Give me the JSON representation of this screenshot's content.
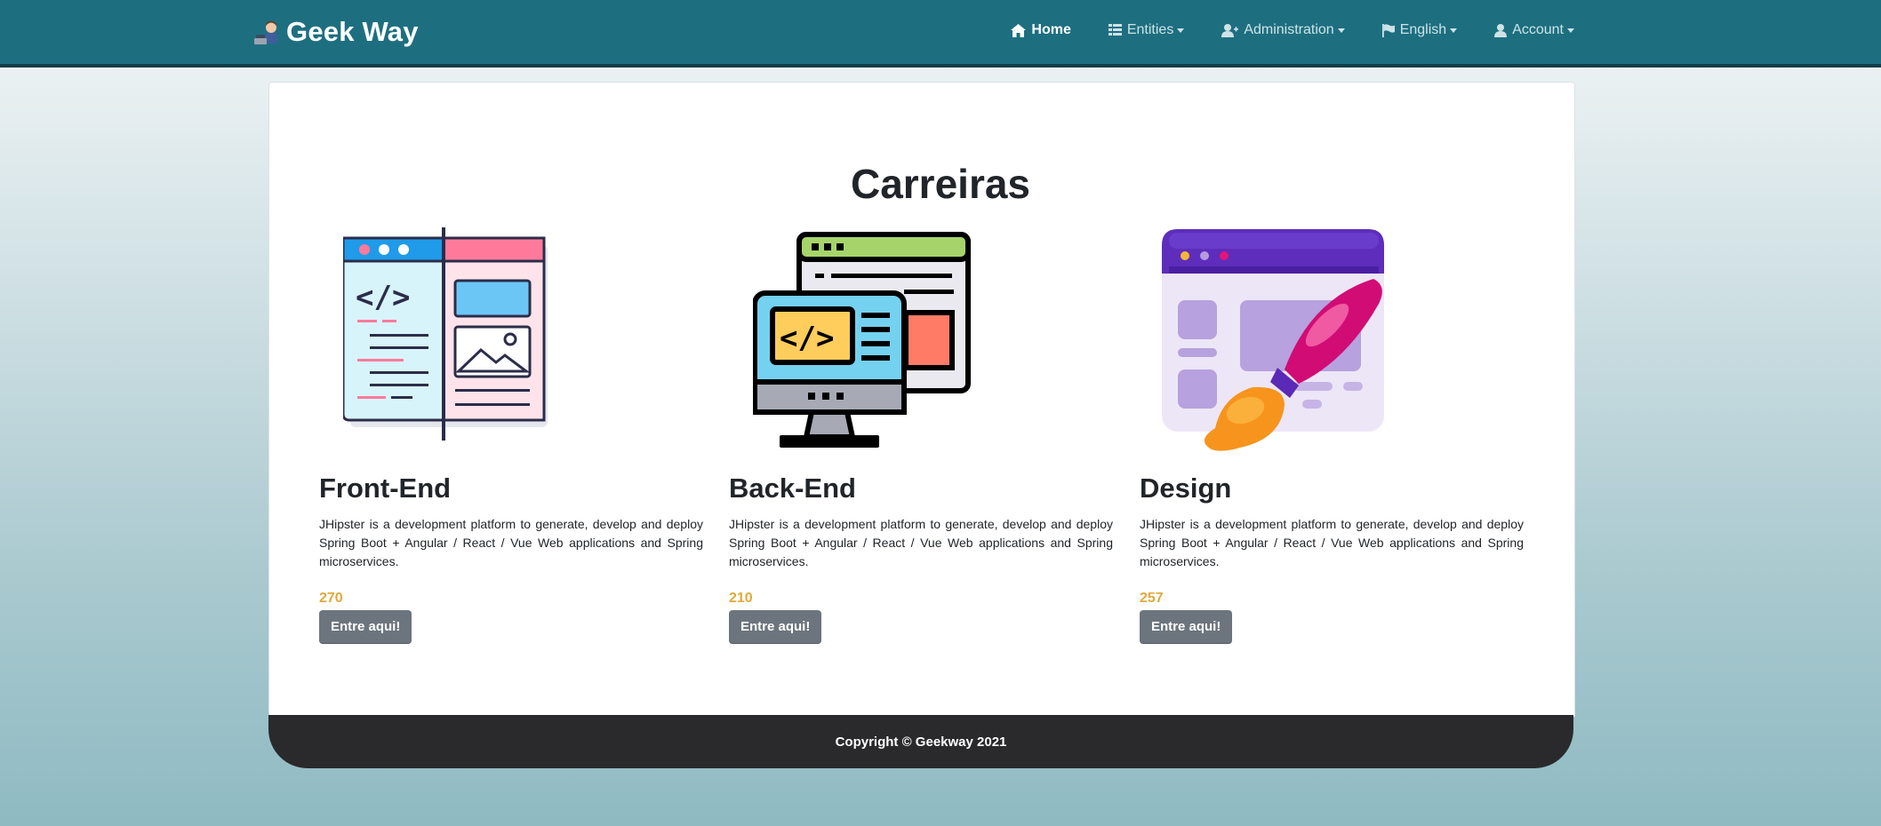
{
  "brand": {
    "name": "Geek Way",
    "logo_icon": "developer-avatar-icon"
  },
  "nav": {
    "items": [
      {
        "label": "Home",
        "icon": "home-icon",
        "active": true,
        "dropdown": false
      },
      {
        "label": "Entities",
        "icon": "table-list-icon",
        "active": false,
        "dropdown": true
      },
      {
        "label": "Administration",
        "icon": "user-plus-icon",
        "active": false,
        "dropdown": true
      },
      {
        "label": "English",
        "icon": "flag-icon",
        "active": false,
        "dropdown": true
      },
      {
        "label": "Account",
        "icon": "user-icon",
        "active": false,
        "dropdown": true
      }
    ]
  },
  "main": {
    "title": "Carreiras",
    "careers": [
      {
        "title": "Front-End",
        "illustration": "front-end-illustration",
        "description": "JHipster is a development platform to generate, develop and deploy Spring Boot + Angular / React / Vue Web applications and Spring microservices.",
        "count": "270",
        "button_label": "Entre aqui!"
      },
      {
        "title": "Back-End",
        "illustration": "back-end-illustration",
        "description": "JHipster is a development platform to generate, develop and deploy Spring Boot + Angular / React / Vue Web applications and Spring microservices.",
        "count": "210",
        "button_label": "Entre aqui!"
      },
      {
        "title": "Design",
        "illustration": "design-illustration",
        "description": "JHipster is a development platform to generate, develop and deploy Spring Boot + Angular / React / Vue Web applications and Spring microservices.",
        "count": "257",
        "button_label": "Entre aqui!"
      }
    ]
  },
  "footer": {
    "copyright": "Copyright © Geekway 2021"
  },
  "colors": {
    "navbar": "#1d6f80",
    "count_accent": "#e0a93b",
    "button": "#6c757d",
    "footer": "#2a2a2c"
  }
}
